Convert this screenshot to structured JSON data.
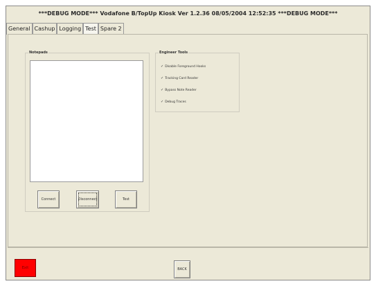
{
  "window": {
    "title": "***DEBUG MODE*** Vodafone B/TopUp Kiosk Ver 1.2.36    08/05/2004 12:52:35  ***DEBUG MODE***"
  },
  "tabs": [
    {
      "label": "General",
      "active": false
    },
    {
      "label": "Cashup",
      "active": false
    },
    {
      "label": "Logging",
      "active": false
    },
    {
      "label": "Test",
      "active": true
    },
    {
      "label": "Spare 2",
      "active": false
    }
  ],
  "notepad": {
    "label": "Notepads",
    "buttons": {
      "connect": "Connect",
      "disconnect": "Disconnect",
      "test": "Test"
    }
  },
  "engineer_tools": {
    "label": "Engineer Tools",
    "items": [
      {
        "label": "Disable Foreground Hooks",
        "checked": true
      },
      {
        "label": "Tracking Card Reader",
        "checked": true
      },
      {
        "label": "Bypass Note Reader",
        "checked": true
      },
      {
        "label": "Debug Traces",
        "checked": true
      }
    ]
  },
  "footer": {
    "exit_label": "Exit",
    "back_label": "BACK"
  },
  "colors": {
    "exit_button": "#ff0000",
    "window_bg": "#ece9d8"
  }
}
